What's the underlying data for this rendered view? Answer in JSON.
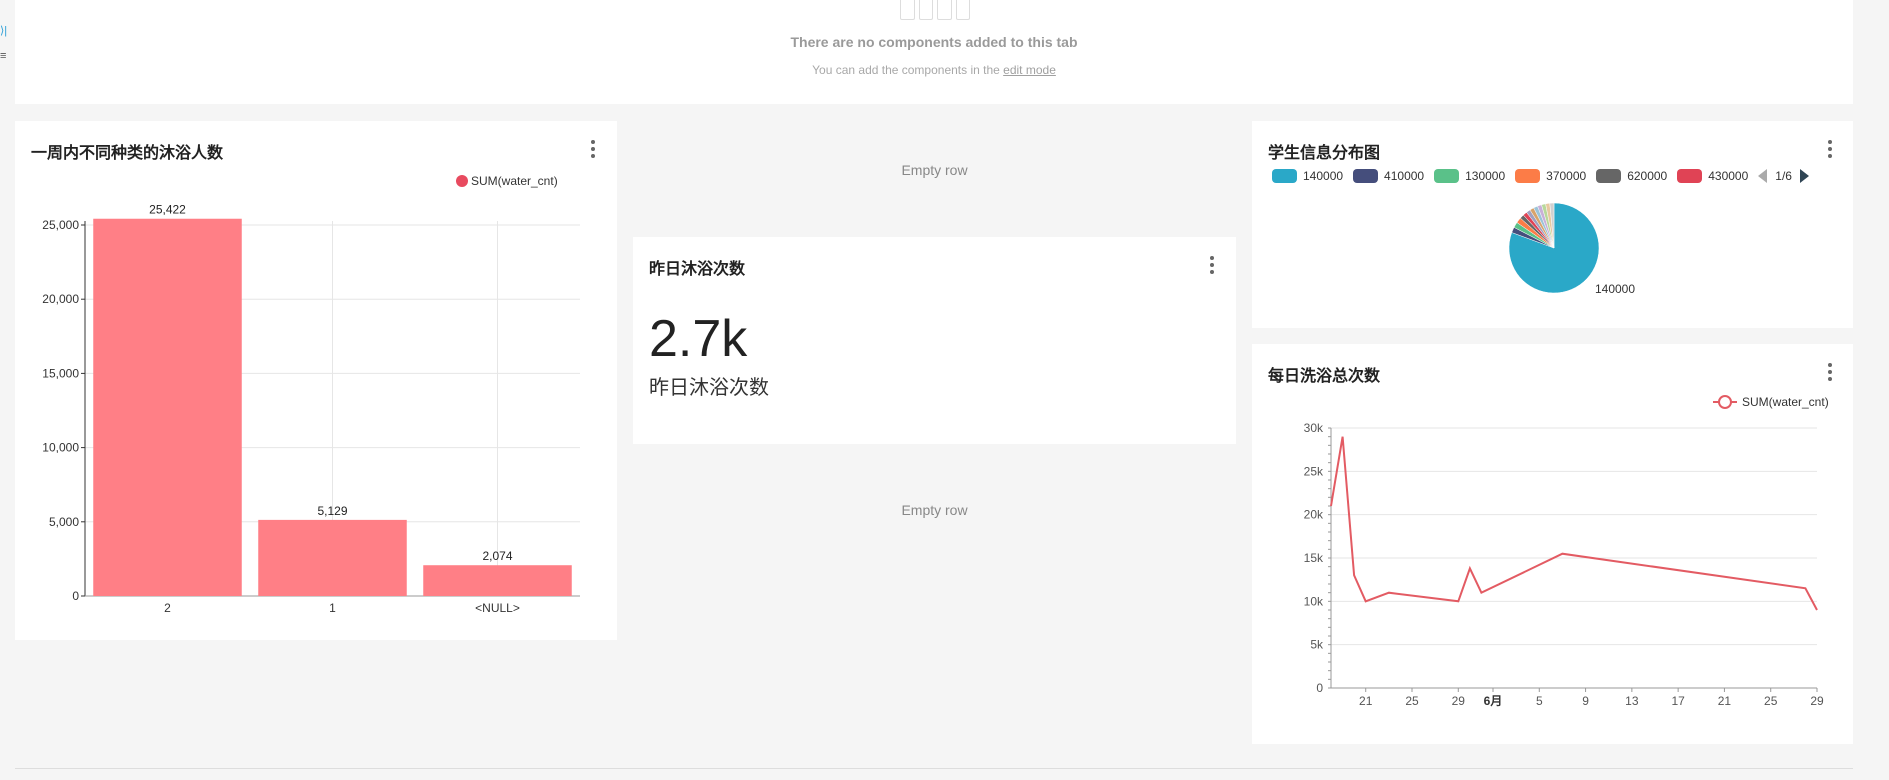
{
  "top_panel": {
    "message": "There are no components added to this tab",
    "sub_text": "You can add the components in the",
    "sub_link": "edit mode"
  },
  "empty_rows": [
    "Empty row",
    "Empty row"
  ],
  "bar_card": {
    "title": "一周内不同种类的沐浴人数",
    "legend": "SUM(water_cnt)",
    "color": "#ff7f86"
  },
  "big_number_card": {
    "title": "昨日沐浴次数",
    "value": "2.7k",
    "subtitle": "昨日沐浴次数"
  },
  "pie_card": {
    "title": "学生信息分布图",
    "legend": [
      {
        "label": "140000",
        "color": "#2aa8c8"
      },
      {
        "label": "410000",
        "color": "#454e7c"
      },
      {
        "label": "130000",
        "color": "#5ac189"
      },
      {
        "label": "370000",
        "color": "#fc7c47"
      },
      {
        "label": "620000",
        "color": "#666666"
      },
      {
        "label": "430000",
        "color": "#e04355"
      }
    ],
    "page": "1/6",
    "slice_label": "140000"
  },
  "line_card": {
    "title": "每日洗浴总次数",
    "legend": "SUM(water_cnt)",
    "color": "#e35b63"
  },
  "chart_data": [
    {
      "type": "bar",
      "title": "一周内不同种类的沐浴人数",
      "categories": [
        "2",
        "1",
        "<NULL>"
      ],
      "series": [
        {
          "name": "SUM(water_cnt)",
          "values": [
            25422,
            5129,
            2074
          ]
        }
      ],
      "data_labels": [
        "25,422",
        "5,129",
        "2,074"
      ],
      "ylim": [
        0,
        25000
      ],
      "yticks": [
        0,
        5000,
        10000,
        15000,
        20000,
        25000
      ],
      "ytick_labels": [
        "0",
        "5,000",
        "10,000",
        "15,000",
        "20,000",
        "25,000"
      ],
      "grid": true,
      "legend_position": "top-right"
    },
    {
      "type": "pie",
      "title": "学生信息分布图",
      "slices": [
        {
          "label": "140000",
          "value": 81,
          "color": "#2aa8c8"
        },
        {
          "label": "410000",
          "value": 2,
          "color": "#454e7c"
        },
        {
          "label": "130000",
          "value": 2,
          "color": "#5ac189"
        },
        {
          "label": "370000",
          "value": 2,
          "color": "#fc7c47"
        },
        {
          "label": "620000",
          "value": 1.5,
          "color": "#666666"
        },
        {
          "label": "430000",
          "value": 1.5,
          "color": "#e04355"
        },
        {
          "label": "",
          "value": 1.5,
          "color": "#a0a0c0"
        },
        {
          "label": "",
          "value": 1.5,
          "color": "#d8a36a"
        },
        {
          "label": "",
          "value": 1.5,
          "color": "#9bc4d8"
        },
        {
          "label": "",
          "value": 1.5,
          "color": "#c8b0d8"
        },
        {
          "label": "",
          "value": 1.5,
          "color": "#b8d89b"
        },
        {
          "label": "",
          "value": 1.5,
          "color": "#e8c8a0"
        },
        {
          "label": "",
          "value": 1.5,
          "color": "#d0d0d0"
        }
      ],
      "legend_position": "top"
    },
    {
      "type": "line",
      "title": "每日洗浴总次数",
      "series": [
        {
          "name": "SUM(water_cnt)",
          "points": [
            [
              "2023-05-18",
              21000
            ],
            [
              "2023-05-19",
              29000
            ],
            [
              "2023-05-20",
              13000
            ],
            [
              "2023-05-21",
              10000
            ],
            [
              "2023-05-23",
              11000
            ],
            [
              "2023-05-29",
              10000
            ],
            [
              "2023-05-30",
              13800
            ],
            [
              "2023-05-31",
              11000
            ],
            [
              "2023-06-07",
              15500
            ],
            [
              "2023-06-28",
              11500
            ],
            [
              "2023-06-29",
              9000
            ]
          ]
        }
      ],
      "xlim": [
        "2023-05-18",
        "2023-06-29"
      ],
      "xticks": [
        {
          "date": "2023-05-21",
          "label": "21"
        },
        {
          "date": "2023-05-25",
          "label": "25"
        },
        {
          "date": "2023-05-29",
          "label": "29"
        },
        {
          "date": "2023-06-01",
          "label": "6月"
        },
        {
          "date": "2023-06-05",
          "label": "5"
        },
        {
          "date": "2023-06-09",
          "label": "9"
        },
        {
          "date": "2023-06-13",
          "label": "13"
        },
        {
          "date": "2023-06-17",
          "label": "17"
        },
        {
          "date": "2023-06-21",
          "label": "21"
        },
        {
          "date": "2023-06-25",
          "label": "25"
        },
        {
          "date": "2023-06-29",
          "label": "29"
        }
      ],
      "ylim": [
        0,
        30000
      ],
      "yticks": [
        0,
        5000,
        10000,
        15000,
        20000,
        25000,
        30000
      ],
      "ytick_labels": [
        "0",
        "5k",
        "10k",
        "15k",
        "20k",
        "25k",
        "30k"
      ],
      "grid": true,
      "legend_position": "top-right"
    }
  ]
}
